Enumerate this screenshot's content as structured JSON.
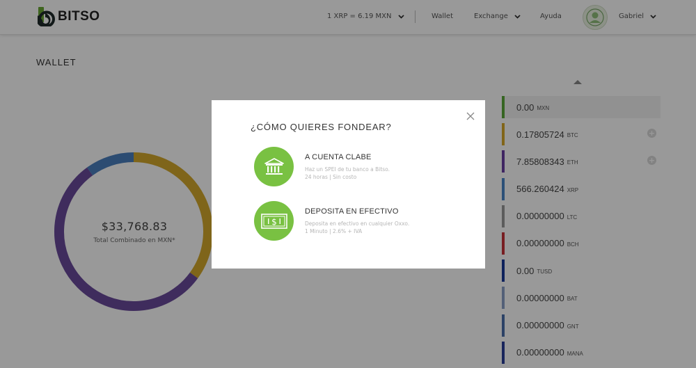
{
  "header": {
    "logo_text": "BITSO",
    "rate_text": "1 XRP = 6.19 MXN",
    "nav": {
      "wallet": "Wallet",
      "exchange": "Exchange",
      "ayuda": "Ayuda"
    },
    "user_name": "Gabriel"
  },
  "page": {
    "title": "WALLET",
    "total_value": "$33,768.83",
    "total_label": "Total Combinado en MXN*"
  },
  "donut_chart": {
    "segments": [
      {
        "currency": "MXN",
        "color": "#5a9a3c",
        "fraction": 0.0
      },
      {
        "currency": "BTC",
        "color": "#d4a92c",
        "fraction": 0.35
      },
      {
        "currency": "ETH",
        "color": "#6a4a9c",
        "fraction": 0.55
      },
      {
        "currency": "XRP",
        "color": "#4a7fbf",
        "fraction": 0.1
      }
    ]
  },
  "balances": [
    {
      "amount": "0.00",
      "currency": "MXN",
      "color": "#5aa83a",
      "has_add": false,
      "active": true
    },
    {
      "amount": "0.17805724",
      "currency": "BTC",
      "color": "#d8a82a",
      "has_add": true,
      "active": false
    },
    {
      "amount": "7.85808343",
      "currency": "ETH",
      "color": "#6a3fa3",
      "has_add": true,
      "active": false
    },
    {
      "amount": "566.260424",
      "currency": "XRP",
      "color": "#4a86c9",
      "has_add": false,
      "active": false
    },
    {
      "amount": "0.00000000",
      "currency": "LTC",
      "color": "#9a9a9a",
      "has_add": false,
      "active": false
    },
    {
      "amount": "0.00000000",
      "currency": "BCH",
      "color": "#c8323a",
      "has_add": false,
      "active": false
    },
    {
      "amount": "0.00",
      "currency": "TUSD",
      "color": "#1a3a9a",
      "has_add": false,
      "active": false
    },
    {
      "amount": "0.00000000",
      "currency": "BAT",
      "color": "#8aa0c8",
      "has_add": false,
      "active": false
    },
    {
      "amount": "0.00000000",
      "currency": "GNT",
      "color": "#4a6eaa",
      "has_add": false,
      "active": false
    },
    {
      "amount": "0.00000000",
      "currency": "MANA",
      "color": "#2a3f9a",
      "has_add": false,
      "active": false
    }
  ],
  "modal": {
    "title": "¿CÓMO QUIERES FONDEAR?",
    "options": [
      {
        "icon": "bank-icon",
        "title": "A CUENTA CLABE",
        "line1": "Haz un SPEI de tu banco a Bitso.",
        "line2": "24 horas | Sin costo"
      },
      {
        "icon": "cash-icon",
        "title": "DEPOSITA EN EFECTIVO",
        "line1": "Deposita en efectivo en cualquier Oxxo.",
        "line2": "1 Minuto | 2.6% + IVA"
      }
    ]
  },
  "colors": {
    "accent_green": "#79c142",
    "overlay": "rgba(0,0,0,0.40)"
  }
}
